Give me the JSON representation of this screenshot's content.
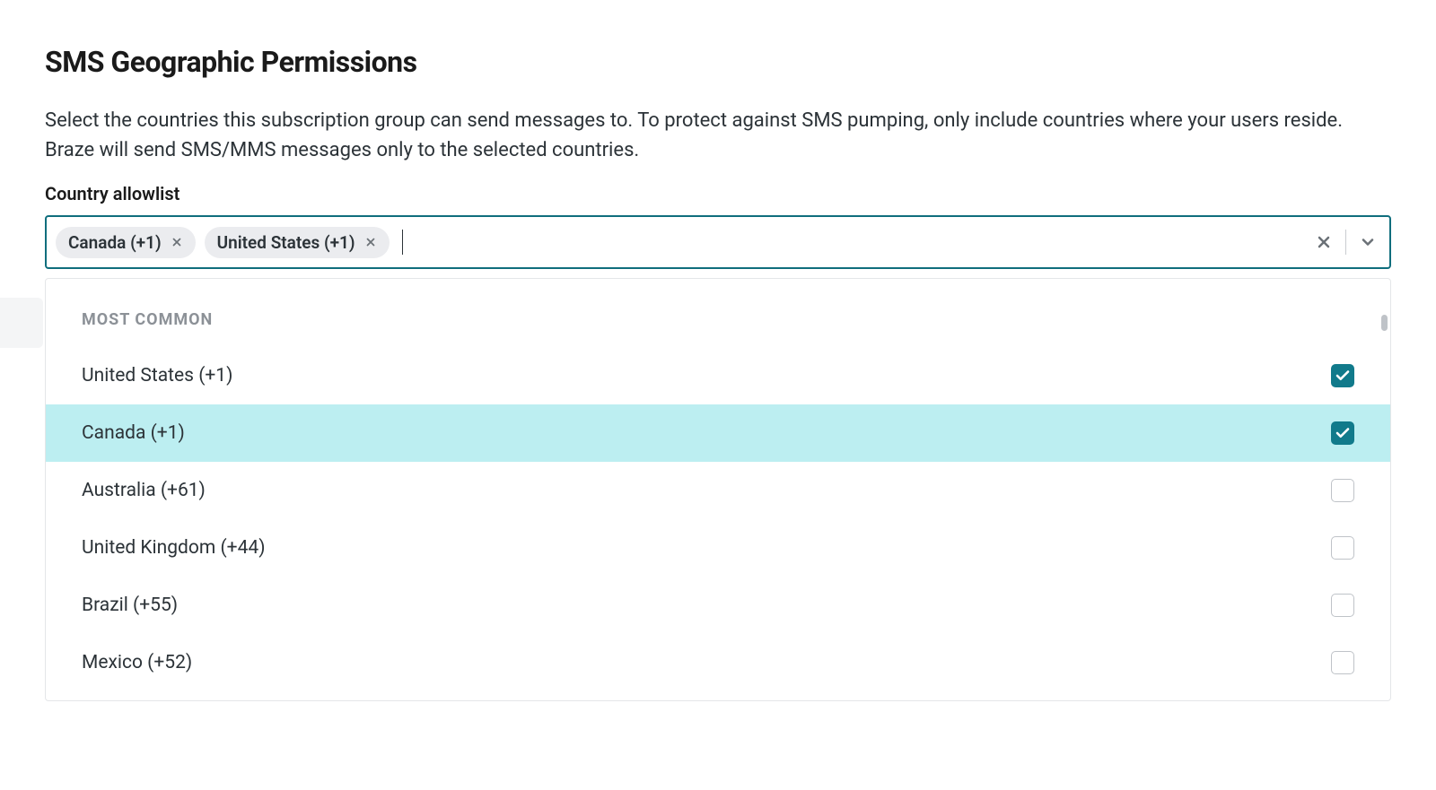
{
  "title": "SMS Geographic Permissions",
  "description": "Select the countries this subscription group can send messages to. To protect against SMS pumping, only include countries where your users reside. Braze will send SMS/MMS messages only to the selected countries.",
  "label": "Country allowlist",
  "selected": [
    {
      "label": "Canada (+1)"
    },
    {
      "label": "United States (+1)"
    }
  ],
  "dropdown": {
    "groupLabel": "MOST COMMON",
    "options": [
      {
        "label": "United States (+1)",
        "checked": true,
        "highlighted": false
      },
      {
        "label": "Canada (+1)",
        "checked": true,
        "highlighted": true
      },
      {
        "label": "Australia (+61)",
        "checked": false,
        "highlighted": false
      },
      {
        "label": "United Kingdom (+44)",
        "checked": false,
        "highlighted": false
      },
      {
        "label": "Brazil (+55)",
        "checked": false,
        "highlighted": false
      },
      {
        "label": "Mexico (+52)",
        "checked": false,
        "highlighted": false
      }
    ]
  }
}
